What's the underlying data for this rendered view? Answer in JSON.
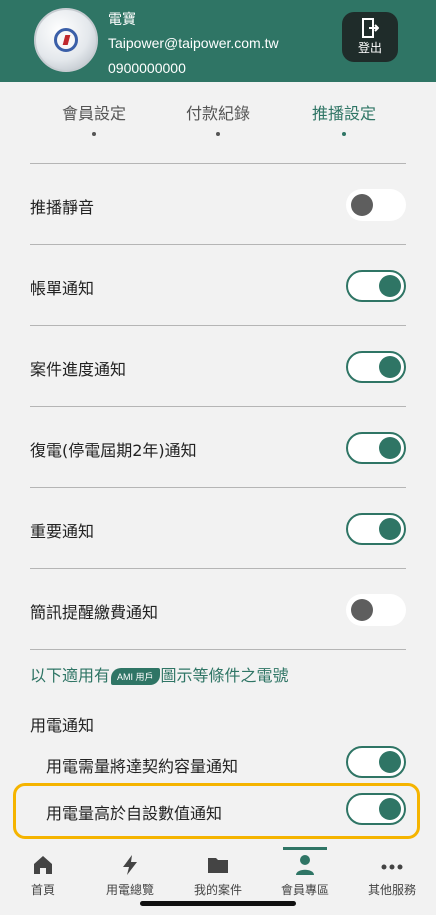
{
  "header": {
    "name": "電寶",
    "email": "Taipower@taipower.com.tw",
    "phone": "0900000000",
    "logout_label": "登出"
  },
  "tabs": [
    {
      "label": "會員設定",
      "active": false
    },
    {
      "label": "付款紀錄",
      "active": false
    },
    {
      "label": "推播設定",
      "active": true
    }
  ],
  "settings": [
    {
      "label": "推播靜音",
      "on": false
    },
    {
      "label": "帳單通知",
      "on": true
    },
    {
      "label": "案件進度通知",
      "on": true
    },
    {
      "label": "復電(停電屆期2年)通知",
      "on": true
    },
    {
      "label": "重要通知",
      "on": true
    },
    {
      "label": "簡訊提醒繳費通知",
      "on": false
    }
  ],
  "ami_note": {
    "prefix": "以下適用有",
    "badge": "AMI 用戶",
    "suffix": "圖示等條件之電號"
  },
  "electricity_section": {
    "title": "用電通知",
    "items": [
      {
        "label": "用電需量將達契約容量通知",
        "on": true
      },
      {
        "label": "用電量高於自設數值通知",
        "on": true
      }
    ]
  },
  "bottom_nav": [
    {
      "label": "首頁",
      "icon": "home-icon",
      "active": false
    },
    {
      "label": "用電總覽",
      "icon": "lightning-icon",
      "active": false
    },
    {
      "label": "我的案件",
      "icon": "folder-icon",
      "active": false
    },
    {
      "label": "會員專區",
      "icon": "person-icon",
      "active": true
    },
    {
      "label": "其他服務",
      "icon": "more-icon",
      "active": false
    }
  ],
  "colors": {
    "brand_green": "#2f7565",
    "highlight": "#f5b400"
  }
}
